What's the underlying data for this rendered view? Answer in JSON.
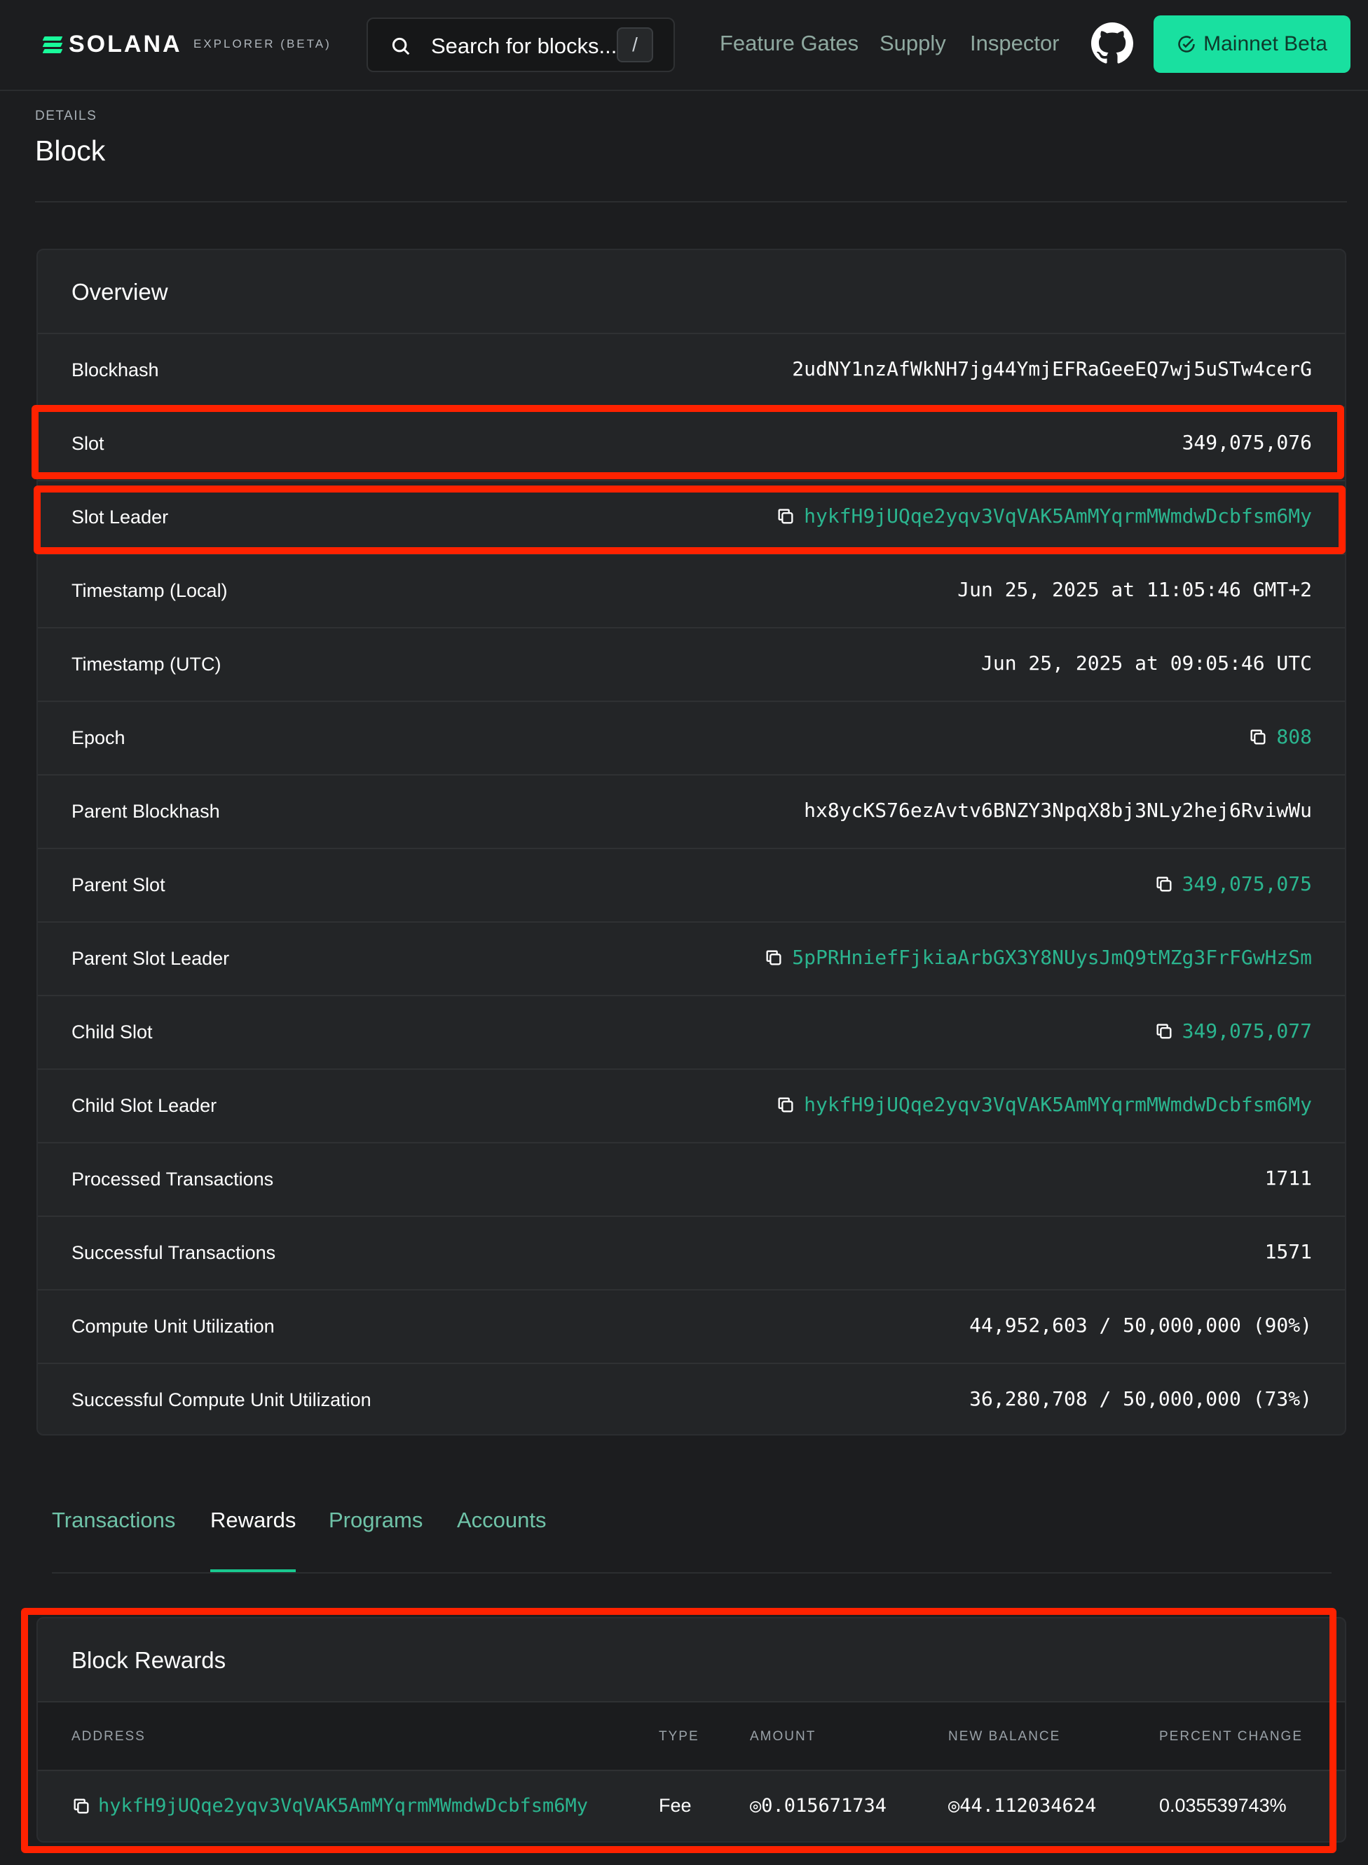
{
  "nav": {
    "logo_text": "SOLANA",
    "logo_sub": "EXPLORER (BETA)",
    "search_placeholder": "Search for blocks...",
    "search_shortcut": "/",
    "links": [
      "Feature Gates",
      "Supply",
      "Inspector"
    ],
    "cluster_button": "Mainnet Beta",
    "colors": {
      "accent": "#19e0a0",
      "link": "#2bb58f",
      "highlight": "#ff2200"
    }
  },
  "page": {
    "eyebrow": "DETAILS",
    "title": "Block"
  },
  "overview": {
    "title": "Overview",
    "rows": [
      {
        "label": "Blockhash",
        "value": "2udNY1nzAfWkNH7jg44YmjEFRaGeeEQ7wj5uSTw4cerG",
        "link": false,
        "copy": false
      },
      {
        "label": "Slot",
        "value": "349,075,076",
        "link": false,
        "copy": false
      },
      {
        "label": "Slot Leader",
        "value": "hykfH9jUQqe2yqv3VqVAK5AmMYqrmMWmdwDcbfsm6My",
        "link": true,
        "copy": true
      },
      {
        "label": "Timestamp (Local)",
        "value": "Jun 25, 2025 at 11:05:46 GMT+2",
        "link": false,
        "copy": false
      },
      {
        "label": "Timestamp (UTC)",
        "value": "Jun 25, 2025 at 09:05:46 UTC",
        "link": false,
        "copy": false
      },
      {
        "label": "Epoch",
        "value": "808",
        "link": true,
        "copy": true
      },
      {
        "label": "Parent Blockhash",
        "value": "hx8ycKS76ezAvtv6BNZY3NpqX8bj3NLy2hej6RviwWu",
        "link": false,
        "copy": false
      },
      {
        "label": "Parent Slot",
        "value": "349,075,075",
        "link": true,
        "copy": true
      },
      {
        "label": "Parent Slot Leader",
        "value": "5pPRHniefFjkiaArbGX3Y8NUysJmQ9tMZg3FrFGwHzSm",
        "link": true,
        "copy": true
      },
      {
        "label": "Child Slot",
        "value": "349,075,077",
        "link": true,
        "copy": true
      },
      {
        "label": "Child Slot Leader",
        "value": "hykfH9jUQqe2yqv3VqVAK5AmMYqrmMWmdwDcbfsm6My",
        "link": true,
        "copy": true
      },
      {
        "label": "Processed Transactions",
        "value": "1711",
        "link": false,
        "copy": false
      },
      {
        "label": "Successful Transactions",
        "value": "1571",
        "link": false,
        "copy": false
      },
      {
        "label": "Compute Unit Utilization",
        "value": "44,952,603 / 50,000,000 (90%)",
        "link": false,
        "copy": false
      },
      {
        "label": "Successful Compute Unit Utilization",
        "value": "36,280,708 / 50,000,000 (73%)",
        "link": false,
        "copy": false
      }
    ]
  },
  "tabs": [
    {
      "label": "Transactions",
      "active": false
    },
    {
      "label": "Rewards",
      "active": true
    },
    {
      "label": "Programs",
      "active": false
    },
    {
      "label": "Accounts",
      "active": false
    }
  ],
  "rewards": {
    "title": "Block Rewards",
    "columns": [
      "ADDRESS",
      "TYPE",
      "AMOUNT",
      "NEW BALANCE",
      "PERCENT CHANGE"
    ],
    "rows": [
      {
        "address": "hykfH9jUQqe2yqv3VqVAK5AmMYqrmMWmdwDcbfsm6My",
        "type": "Fee",
        "amount": "◎0.015671734",
        "new_balance": "◎44.112034624",
        "percent_change": "0.035539743%"
      }
    ]
  }
}
